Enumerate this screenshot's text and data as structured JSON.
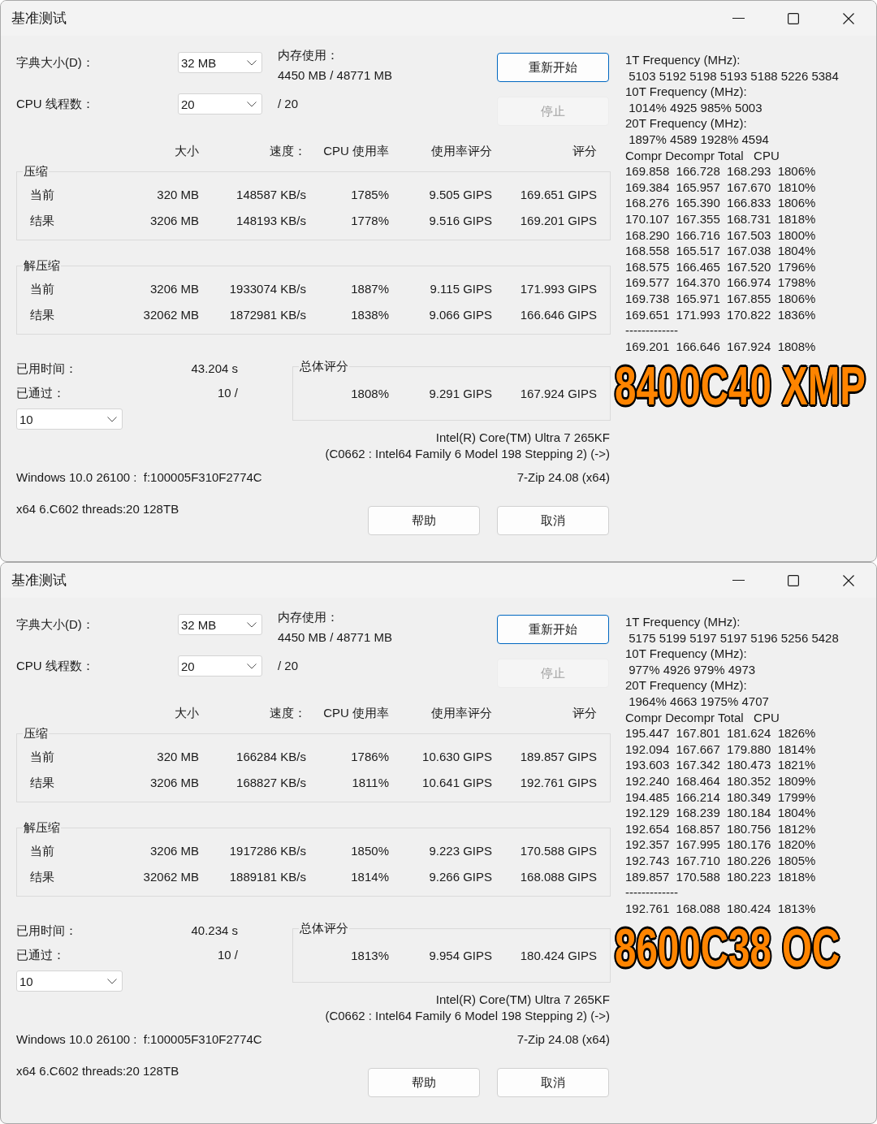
{
  "windows": [
    {
      "title": "基准测试",
      "dictionary_size": {
        "label": "字典大小(D)：",
        "value": "32 MB"
      },
      "memory_usage": {
        "label": "内存使用：",
        "value": "4450 MB / 48771 MB"
      },
      "cpu_threads": {
        "label": "CPU 线程数：",
        "value": "20",
        "total": "/ 20"
      },
      "action_buttons": [
        {
          "label": "重新开始",
          "default": true,
          "disabled": false
        },
        {
          "label": "停止",
          "default": false,
          "disabled": true
        }
      ],
      "columns": [
        "大小",
        "速度：",
        "CPU 使用率",
        "使用率评分",
        "评分"
      ],
      "groups": [
        {
          "title": "压缩",
          "rows": [
            {
              "label": "当前",
              "values": [
                "320 MB",
                "148587 KB/s",
                "1785%",
                "9.505 GIPS",
                "169.651 GIPS"
              ]
            },
            {
              "label": "结果",
              "values": [
                "3206 MB",
                "148193 KB/s",
                "1778%",
                "9.516 GIPS",
                "169.201 GIPS"
              ]
            }
          ]
        },
        {
          "title": "解压缩",
          "rows": [
            {
              "label": "当前",
              "values": [
                "3206 MB",
                "1933074 KB/s",
                "1887%",
                "9.115 GIPS",
                "171.993 GIPS"
              ]
            },
            {
              "label": "结果",
              "values": [
                "32062 MB",
                "1872981 KB/s",
                "1838%",
                "9.066 GIPS",
                "166.646 GIPS"
              ]
            }
          ]
        }
      ],
      "elapsed_time": {
        "label": "已用时间：",
        "value": "43.204 s"
      },
      "passes": {
        "label": "已通过：",
        "value": "10 /",
        "select_value": "10"
      },
      "overall_rating": {
        "title": "总体评分",
        "values": [
          "1808%",
          "9.291 GIPS",
          "167.924 GIPS"
        ]
      },
      "cpu_info": [
        "Intel(R) Core(TM) Ultra 7 265KF",
        "(C0662 : Intel64 Family 6 Model 198 Stepping 2) (->)"
      ],
      "system_info": "Windows 10.0 26100 :  f:100005F310F2774C",
      "version": "7-Zip 24.08 (x64)",
      "arch_info": "x64 6.C602 threads:20 128TB",
      "dialog_buttons": [
        "帮助",
        "取消"
      ],
      "log_lines": [
        "1T Frequency (MHz):",
        " 5103 5192 5198 5193 5188 5226 5384",
        "10T Frequency (MHz):",
        " 1014% 4925 985% 5003",
        "20T Frequency (MHz):",
        " 1897% 4589 1928% 4594",
        "Compr Decompr Total   CPU",
        "169.858  166.728  168.293  1806%",
        "169.384  165.957  167.670  1810%",
        "168.276  165.390  166.833  1806%",
        "170.107  167.355  168.731  1818%",
        "168.290  166.716  167.503  1800%",
        "168.558  165.517  167.038  1804%",
        "168.575  166.465  167.520  1796%",
        "169.577  164.370  166.974  1798%",
        "169.738  165.971  167.855  1806%",
        "169.651  171.993  170.822  1836%",
        "-------------",
        "169.201  166.646  167.924  1808%"
      ],
      "overlay_label": "8400C40 XMP"
    },
    {
      "title": "基准测试",
      "dictionary_size": {
        "label": "字典大小(D)：",
        "value": "32 MB"
      },
      "memory_usage": {
        "label": "内存使用：",
        "value": "4450 MB / 48771 MB"
      },
      "cpu_threads": {
        "label": "CPU 线程数：",
        "value": "20",
        "total": "/ 20"
      },
      "action_buttons": [
        {
          "label": "重新开始",
          "default": true,
          "disabled": false
        },
        {
          "label": "停止",
          "default": false,
          "disabled": true
        }
      ],
      "columns": [
        "大小",
        "速度：",
        "CPU 使用率",
        "使用率评分",
        "评分"
      ],
      "groups": [
        {
          "title": "压缩",
          "rows": [
            {
              "label": "当前",
              "values": [
                "320 MB",
                "166284 KB/s",
                "1786%",
                "10.630 GIPS",
                "189.857 GIPS"
              ]
            },
            {
              "label": "结果",
              "values": [
                "3206 MB",
                "168827 KB/s",
                "1811%",
                "10.641 GIPS",
                "192.761 GIPS"
              ]
            }
          ]
        },
        {
          "title": "解压缩",
          "rows": [
            {
              "label": "当前",
              "values": [
                "3206 MB",
                "1917286 KB/s",
                "1850%",
                "9.223 GIPS",
                "170.588 GIPS"
              ]
            },
            {
              "label": "结果",
              "values": [
                "32062 MB",
                "1889181 KB/s",
                "1814%",
                "9.266 GIPS",
                "168.088 GIPS"
              ]
            }
          ]
        }
      ],
      "elapsed_time": {
        "label": "已用时间：",
        "value": "40.234 s"
      },
      "passes": {
        "label": "已通过：",
        "value": "10 /",
        "select_value": "10"
      },
      "overall_rating": {
        "title": "总体评分",
        "values": [
          "1813%",
          "9.954 GIPS",
          "180.424 GIPS"
        ]
      },
      "cpu_info": [
        "Intel(R) Core(TM) Ultra 7 265KF",
        "(C0662 : Intel64 Family 6 Model 198 Stepping 2) (->)"
      ],
      "system_info": "Windows 10.0 26100 :  f:100005F310F2774C",
      "version": "7-Zip 24.08 (x64)",
      "arch_info": "x64 6.C602 threads:20 128TB",
      "dialog_buttons": [
        "帮助",
        "取消"
      ],
      "log_lines": [
        "1T Frequency (MHz):",
        " 5175 5199 5197 5197 5196 5256 5428",
        "10T Frequency (MHz):",
        " 977% 4926 979% 4973",
        "20T Frequency (MHz):",
        " 1964% 4663 1975% 4707",
        "Compr Decompr Total   CPU",
        "195.447  167.801  181.624  1826%",
        "192.094  167.667  179.880  1814%",
        "193.603  167.342  180.473  1821%",
        "192.240  168.464  180.352  1809%",
        "194.485  166.214  180.349  1799%",
        "192.129  168.239  180.184  1804%",
        "192.654  168.857  180.756  1812%",
        "192.357  167.995  180.176  1820%",
        "192.743  167.710  180.226  1805%",
        "189.857  170.588  180.223  1818%",
        "-------------",
        "192.761  168.088  180.424  1813%"
      ],
      "overlay_label": "8600C38 OC"
    }
  ]
}
